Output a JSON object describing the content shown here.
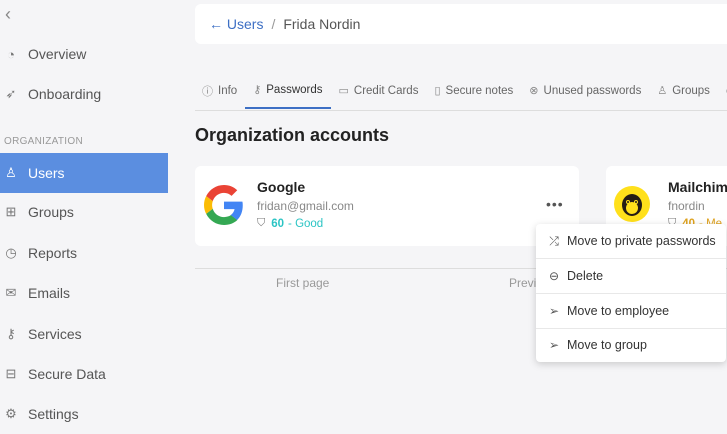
{
  "sidebar": {
    "items": [
      {
        "label": "Overview",
        "icon": "speedometer-icon"
      },
      {
        "label": "Onboarding",
        "icon": "rocket-icon"
      },
      {
        "label": "Users",
        "icon": "users-icon"
      },
      {
        "label": "Groups",
        "icon": "groups-icon"
      },
      {
        "label": "Reports",
        "icon": "clock-icon"
      },
      {
        "label": "Emails",
        "icon": "mail-icon"
      },
      {
        "label": "Services",
        "icon": "key-icon"
      },
      {
        "label": "Secure Data",
        "icon": "briefcase-icon"
      },
      {
        "label": "Settings",
        "icon": "gear-icon"
      }
    ],
    "section_label": "ORGANIZATION",
    "active_item": "Users"
  },
  "header": {
    "back_label": "← Users",
    "separator": "/",
    "current": "Frida Nordin"
  },
  "tabs": [
    {
      "label": "Info",
      "icon": "info-icon"
    },
    {
      "label": "Passwords",
      "icon": "key-icon",
      "active": true
    },
    {
      "label": "Credit Cards",
      "icon": "credit-card-icon"
    },
    {
      "label": "Secure notes",
      "icon": "note-icon"
    },
    {
      "label": "Unused passwords",
      "icon": "x-circle-icon"
    },
    {
      "label": "Groups",
      "icon": "groups-icon"
    }
  ],
  "section_title": "Organization accounts",
  "accounts": [
    {
      "name": "Google",
      "username": "fridan@gmail.com",
      "score": "60",
      "score_label": "- Good",
      "score_color": "#2bc4c4",
      "logo": "google-logo"
    },
    {
      "name": "Mailchim",
      "username": "fnordin",
      "score": "40",
      "score_label": "- Me",
      "score_color": "#e0a31e",
      "logo": "mailchimp-logo"
    }
  ],
  "pagination": {
    "first": "First page",
    "prev": "Previ"
  },
  "context_menu": [
    {
      "label": "Move to private passwords",
      "icon": "shuffle-icon"
    },
    {
      "label": "Delete",
      "icon": "minus-circle-icon"
    },
    {
      "label": "Move to employee",
      "icon": "send-icon"
    },
    {
      "label": "Move to group",
      "icon": "send-icon"
    }
  ],
  "colors": {
    "accent": "#5b8ee0",
    "link": "#3d6fc4",
    "good": "#2bc4c4",
    "medium": "#e0a31e"
  }
}
